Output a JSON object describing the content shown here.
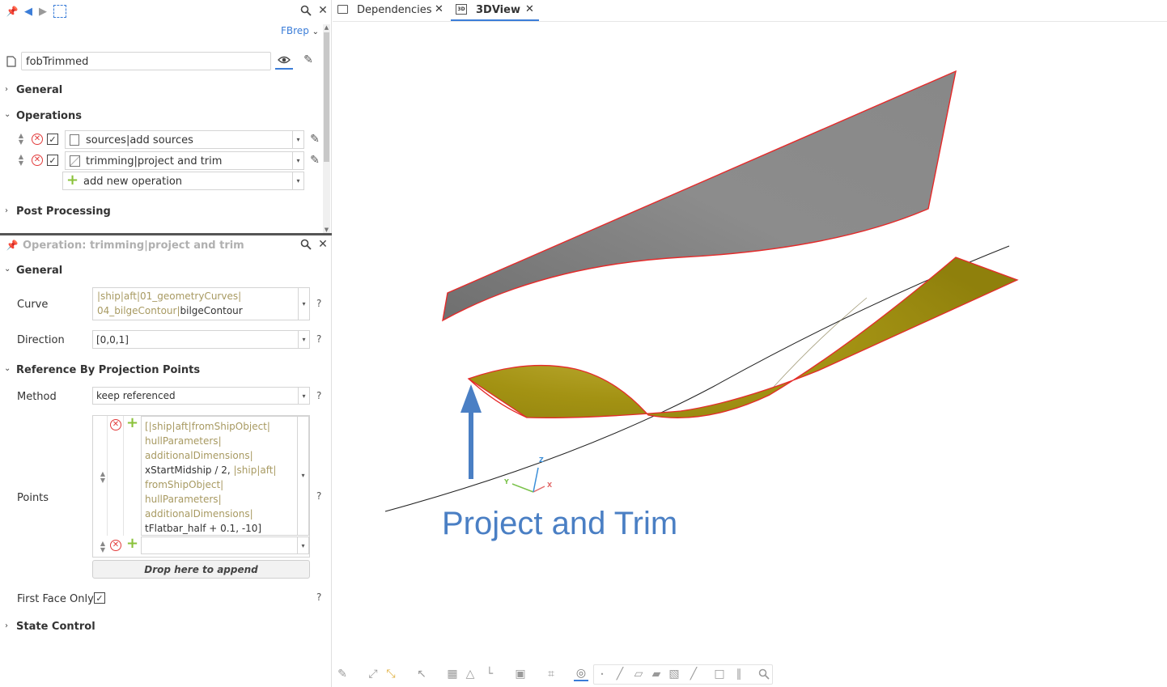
{
  "top_panel": {
    "type_label": "FBrep",
    "object_name": "fobTrimmed",
    "sections": {
      "general": "General",
      "operations": "Operations",
      "post_processing": "Post Processing"
    },
    "operations": [
      {
        "label": "sources|add sources",
        "checked": true
      },
      {
        "label": "trimming|project and trim",
        "checked": true
      }
    ],
    "add_operation": "add new operation"
  },
  "bottom_panel": {
    "title": "Operation: trimming|project and trim",
    "sections": {
      "general": "General",
      "reference": "Reference By Projection Points",
      "state_control": "State Control"
    },
    "curve": {
      "label": "Curve",
      "line1": "|ship|aft|01_geometryCurves|",
      "line2_ref": "04_bilgeContour|",
      "line2_name": "bilgeContour"
    },
    "direction": {
      "label": "Direction",
      "value": "[0,0,1]"
    },
    "method": {
      "label": "Method",
      "value": "keep referenced"
    },
    "points": {
      "label": "Points",
      "lines": [
        {
          "text": "[|ship|aft|fromShipObject|",
          "ref": true
        },
        {
          "text": "hullParameters|",
          "ref": true
        },
        {
          "text": "additionalDimensions|",
          "ref": true
        },
        {
          "text": "xStartMidship / 2, ",
          "ref": false,
          "suffix": "|ship|aft|"
        },
        {
          "text": "fromShipObject|",
          "ref": true
        },
        {
          "text": "hullParameters|",
          "ref": true
        },
        {
          "text": "additionalDimensions|",
          "ref": true
        },
        {
          "text": "tFlatbar_half + 0.1, -10]",
          "ref": false
        }
      ]
    },
    "drop_label": "Drop here to append",
    "first_face_only": {
      "label": "First Face Only",
      "checked": true
    },
    "help": "?"
  },
  "tabs": [
    {
      "label": "Dependencies",
      "active": false,
      "icon": "monitor-icon"
    },
    {
      "label": "3DView",
      "active": true,
      "icon": "3d-icon",
      "icon_text": "3D"
    }
  ],
  "viewport": {
    "annotation": "Project and Trim",
    "axis_labels": {
      "x": "X",
      "y": "Y",
      "z": "Z"
    },
    "colors": {
      "upper_surface": "#8a8a8a",
      "lower_surface": "#a89612",
      "edge": "#e52a2a",
      "arrow": "#4a7fc4",
      "curve": "#222222"
    }
  }
}
